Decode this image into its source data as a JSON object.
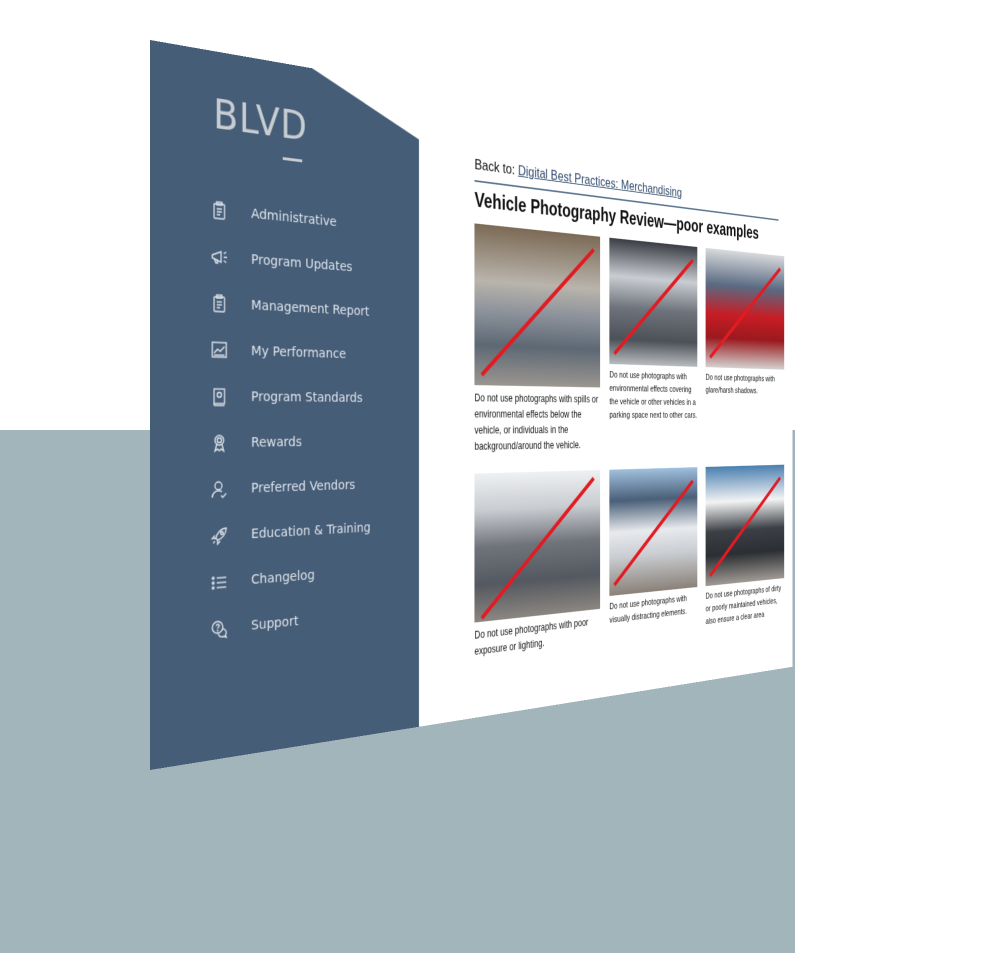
{
  "colors": {
    "sidebar_bg": "#465d77",
    "backdrop": "#a1b5bb",
    "strike": "#e21b23",
    "link": "#2f4a6b"
  },
  "sidebar": {
    "logo": "BLVD",
    "items": [
      {
        "label": "Administrative",
        "icon": "clipboard-icon"
      },
      {
        "label": "Program Updates",
        "icon": "megaphone-icon"
      },
      {
        "label": "Management Report",
        "icon": "clipboard-icon"
      },
      {
        "label": "My Performance",
        "icon": "chart-icon"
      },
      {
        "label": "Program Standards",
        "icon": "book-gear-icon"
      },
      {
        "label": "Rewards",
        "icon": "award-icon"
      },
      {
        "label": "Preferred Vendors",
        "icon": "user-check-icon"
      },
      {
        "label": "Education & Training",
        "icon": "rocket-icon"
      },
      {
        "label": "Changelog",
        "icon": "list-icon"
      },
      {
        "label": "Support",
        "icon": "help-chat-icon"
      }
    ]
  },
  "content": {
    "back_prefix": "Back to:",
    "back_link": "Digital Best Practices: Merchandising",
    "title": "Vehicle Photography Review—poor examples",
    "cards": [
      {
        "caption": "Do not use photographs with spills or environmental effects below the vehicle, or individuals in the background/around the vehicle."
      },
      {
        "caption": "Do not use photographs with environmental effects covering the vehicle or other vehicles in a parking space next to other cars."
      },
      {
        "caption": "Do not use photographs with glare/harsh shadows."
      },
      {
        "caption": "Do not use photographs with poor exposure or lighting."
      },
      {
        "caption": "Do not use photographs with visually distracting elements."
      },
      {
        "caption": "Do not use photographs of dirty or poorly maintained vehicles, also ensure a clear area"
      }
    ]
  }
}
